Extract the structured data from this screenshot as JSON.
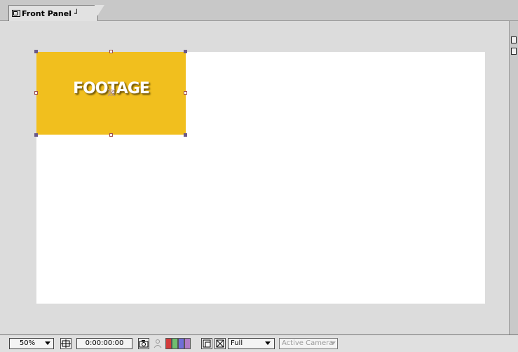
{
  "tab": {
    "title": "Front Panel",
    "menu_glyph": "┘"
  },
  "footage": {
    "label": "FOOTAGE",
    "color": "#f1bf1e"
  },
  "status": {
    "zoom": "50%",
    "timecode": "0:00:00:00",
    "resolution": "Full",
    "camera": "Active Camera"
  },
  "icons": {
    "tab": "composition-icon",
    "fit": "safe-margins-icon",
    "snapshot": "camera-snapshot-icon",
    "show_snapshot": "person-icon",
    "transparency": "transparency-grid-icon",
    "region": "region-of-interest-icon"
  },
  "colors": {
    "canvas": "#ffffff",
    "pasteboard": "#dcdcdc",
    "red_channel": "#d23c3c",
    "green_channel": "#6fbf6f",
    "blue_channel": "#6f6fd8",
    "alpha_channel": "#b07cc6"
  }
}
